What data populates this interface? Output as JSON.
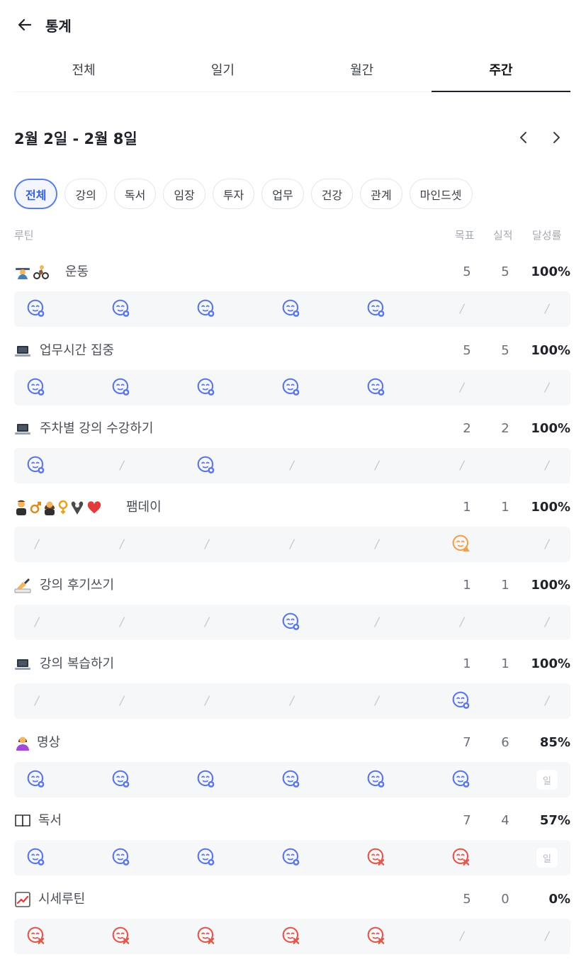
{
  "header": {
    "title": "통계",
    "back_icon": "arrow-left-icon"
  },
  "tabs": [
    {
      "label": "전체",
      "active": false
    },
    {
      "label": "일기",
      "active": false
    },
    {
      "label": "월간",
      "active": false
    },
    {
      "label": "주간",
      "active": true
    }
  ],
  "week": {
    "label": "2월 2일 - 2월 8일",
    "prev_icon": "chevron-left-icon",
    "next_icon": "chevron-right-icon"
  },
  "filters": [
    {
      "label": "전체",
      "active": true
    },
    {
      "label": "강의",
      "active": false
    },
    {
      "label": "독서",
      "active": false
    },
    {
      "label": "임장",
      "active": false
    },
    {
      "label": "투자",
      "active": false
    },
    {
      "label": "업무",
      "active": false
    },
    {
      "label": "건강",
      "active": false
    },
    {
      "label": "관계",
      "active": false
    },
    {
      "label": "마인드셋",
      "active": false
    }
  ],
  "columns": {
    "routine": "루틴",
    "goal": "목표",
    "actual": "실적",
    "rate": "달성률"
  },
  "colors": {
    "done": "#5b78e6",
    "missed": "#e0584e",
    "late": "#f0a24a",
    "chip_active": "#3761d6"
  },
  "rest_label": "일",
  "routines": [
    {
      "name": "운동",
      "icon": [
        "person-lifting-icon",
        "person-biking-icon"
      ],
      "goal": "5",
      "actual": "5",
      "rate": "100%",
      "days": [
        "done",
        "done",
        "done",
        "done",
        "done",
        "none",
        "none"
      ]
    },
    {
      "name": "업무시간 집중",
      "icon": [
        "laptop-icon"
      ],
      "goal": "5",
      "actual": "5",
      "rate": "100%",
      "days": [
        "done",
        "done",
        "done",
        "done",
        "done",
        "none",
        "none"
      ]
    },
    {
      "name": "주차별 강의 수강하기",
      "icon": [
        "laptop-icon"
      ],
      "goal": "2",
      "actual": "2",
      "rate": "100%",
      "days": [
        "done",
        "none",
        "done",
        "none",
        "none",
        "none",
        "none"
      ]
    },
    {
      "name": "팸데이",
      "icon": [
        "man-icon",
        "male-sign-icon",
        "woman-icon",
        "female-sign-icon",
        "baby-icon",
        "red-heart-icon"
      ],
      "goal": "1",
      "actual": "1",
      "rate": "100%",
      "days": [
        "none",
        "none",
        "none",
        "none",
        "none",
        "late",
        "none"
      ]
    },
    {
      "name": "강의 후기쓰기",
      "icon": [
        "writing-hand-icon"
      ],
      "goal": "1",
      "actual": "1",
      "rate": "100%",
      "days": [
        "none",
        "none",
        "none",
        "done",
        "none",
        "none",
        "none"
      ]
    },
    {
      "name": "강의 복습하기",
      "icon": [
        "laptop-icon"
      ],
      "goal": "1",
      "actual": "1",
      "rate": "100%",
      "days": [
        "none",
        "none",
        "none",
        "none",
        "none",
        "done",
        "none"
      ]
    },
    {
      "name": "명상",
      "icon": [
        "person-meditating-icon"
      ],
      "goal": "7",
      "actual": "6",
      "rate": "85%",
      "days": [
        "done",
        "done",
        "done",
        "done",
        "done",
        "done",
        "rest"
      ]
    },
    {
      "name": "독서",
      "icon": [
        "book-icon"
      ],
      "goal": "7",
      "actual": "4",
      "rate": "57%",
      "days": [
        "done",
        "done",
        "done",
        "done",
        "missed",
        "missed",
        "rest"
      ]
    },
    {
      "name": "시세루틴",
      "icon": [
        "chart-increasing-icon"
      ],
      "goal": "5",
      "actual": "0",
      "rate": "0%",
      "days": [
        "missed",
        "missed",
        "missed",
        "missed",
        "missed",
        "none",
        "none"
      ]
    }
  ]
}
